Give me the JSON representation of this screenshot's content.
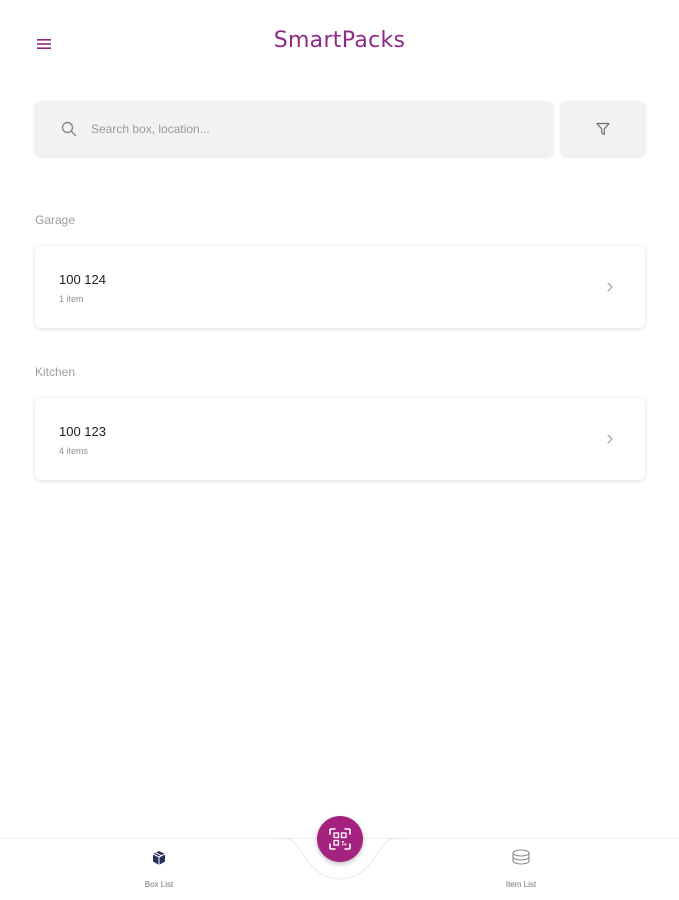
{
  "app": {
    "title": "SmartPacks",
    "brand_color": "#8e2a86"
  },
  "header": {
    "menu_icon": "menu-icon"
  },
  "search": {
    "placeholder": "Search box, location...",
    "value": "",
    "filter_icon": "filter-icon"
  },
  "groups": [
    {
      "label": "Garage",
      "boxes": [
        {
          "id": "100 124",
          "count": "1 item"
        }
      ]
    },
    {
      "label": "Kitchen",
      "boxes": [
        {
          "id": "100 123",
          "count": "4 items"
        }
      ]
    }
  ],
  "bottom_nav": {
    "items": [
      {
        "label": "Box List",
        "icon": "box-icon",
        "active": true
      },
      {
        "label": "Item List",
        "icon": "layers-icon",
        "active": false
      }
    ],
    "fab_icon": "qr-scan-icon",
    "fab_color": "#a4217f"
  }
}
